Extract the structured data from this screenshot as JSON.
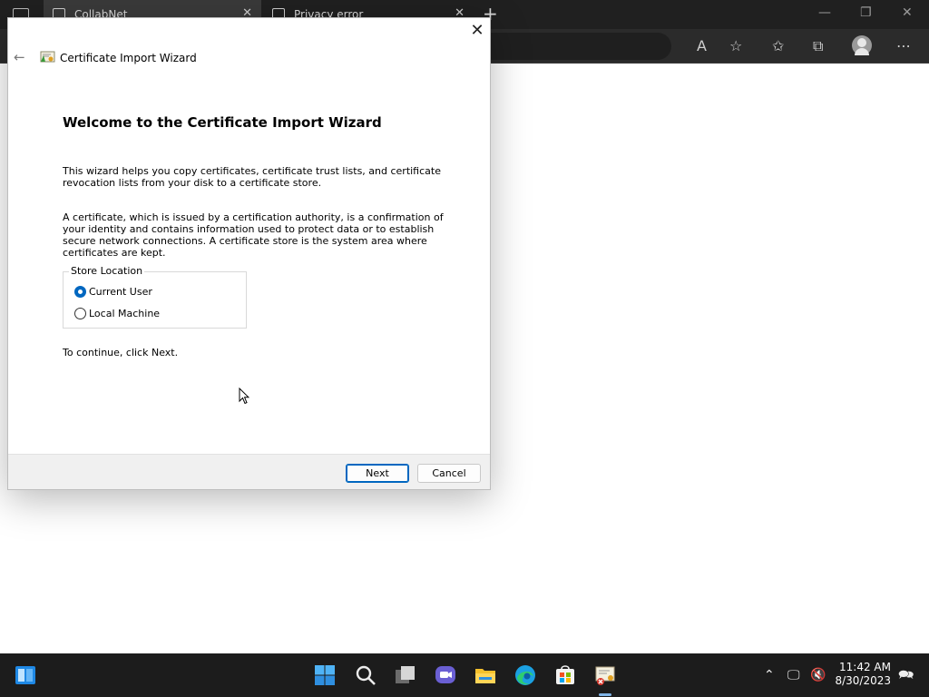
{
  "browser": {
    "tabs": [
      {
        "label": "CollabNet"
      },
      {
        "label": "Privacy error"
      }
    ],
    "new_tab_symbol": "+",
    "toolbar_icons": [
      "read-aloud-icon",
      "add-favorite-icon",
      "favorites-icon",
      "collections-icon",
      "profile-icon",
      "more-icon"
    ]
  },
  "wizard": {
    "title": "Certificate Import Wizard",
    "heading": "Welcome to the Certificate Import Wizard",
    "paragraph_1": "This wizard helps you copy certificates, certificate trust lists, and certificate revocation lists from your disk to a certificate store.",
    "paragraph_2": "A certificate, which is issued by a certification authority, is a confirmation of your identity and contains information used to protect data or to establish secure network connections. A certificate store is the system area where certificates are kept.",
    "store_location": {
      "label": "Store Location",
      "options": [
        {
          "label": "Current User",
          "checked": true
        },
        {
          "label": "Local Machine",
          "checked": false
        }
      ]
    },
    "continue_text": "To continue, click Next.",
    "next_label": "Next",
    "cancel_label": "Cancel"
  },
  "taskbar": {
    "apps": [
      "widgets-icon",
      "start-icon",
      "search-icon",
      "task-view-icon",
      "teams-chat-icon",
      "file-explorer-icon",
      "edge-icon",
      "store-icon",
      "certificate-manager-icon"
    ],
    "clock": {
      "time": "11:42 AM",
      "date": "8/30/2023"
    }
  },
  "colors": {
    "accent": "#0067c0",
    "taskbar": "#1c1c1c",
    "browser_chrome": "#202020"
  }
}
